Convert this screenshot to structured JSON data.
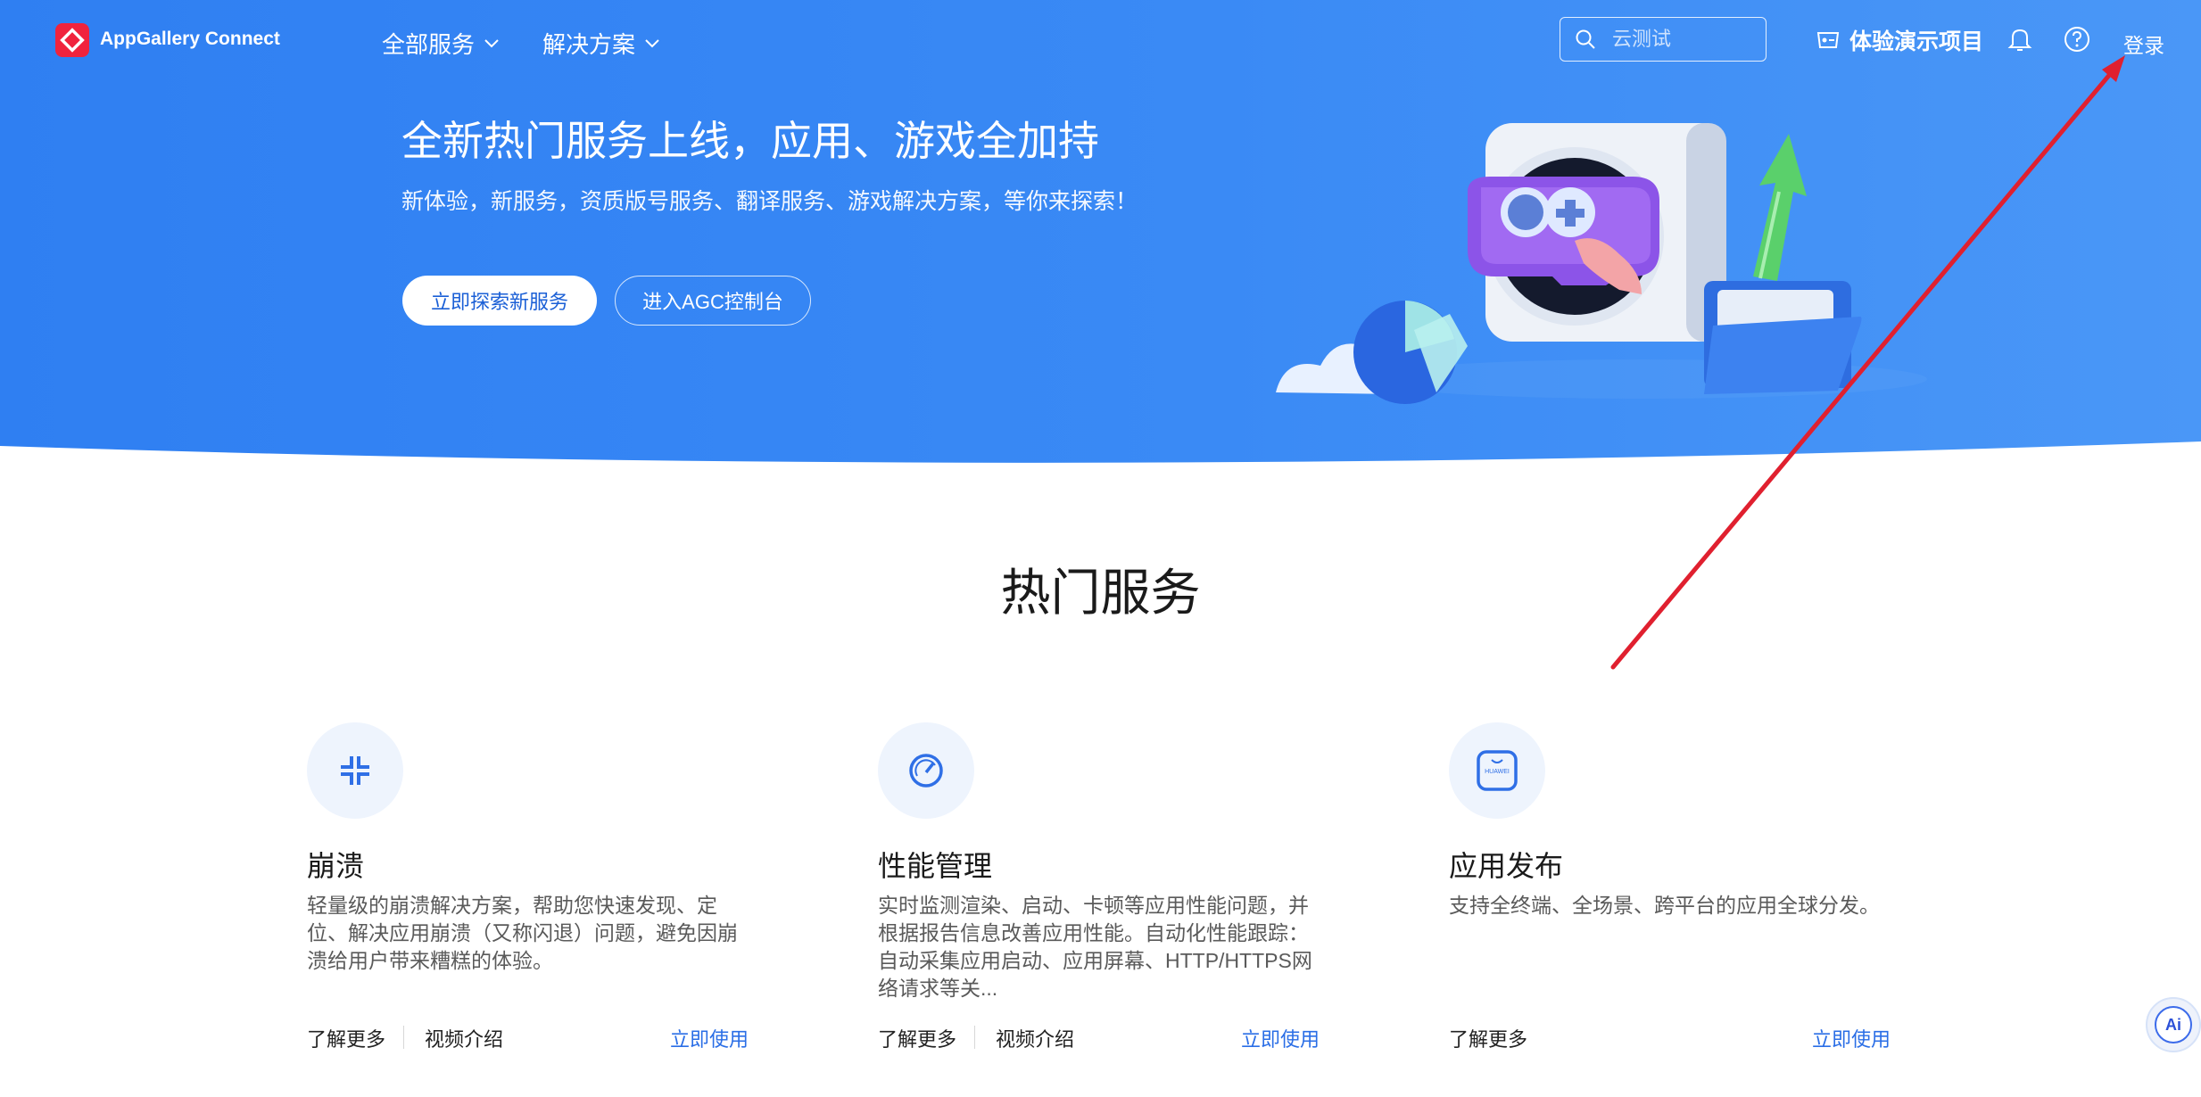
{
  "header": {
    "brand": "AppGallery Connect",
    "nav": [
      {
        "label": "全部服务"
      },
      {
        "label": "解决方案"
      }
    ],
    "search_placeholder": "云测试",
    "demo_label": "体验演示项目",
    "login_label": "登录"
  },
  "hero": {
    "title": "全新热门服务上线，应用、游戏全加持",
    "subtitle": "新体验，新服务，资质版号服务、翻译服务、游戏解决方案，等你来探索！",
    "primary_button": "立即探索新服务",
    "secondary_button": "进入AGC控制台"
  },
  "services": {
    "title": "热门服务",
    "cards": [
      {
        "title": "崩溃",
        "desc": "轻量级的崩溃解决方案，帮助您快速发现、定位、解决应用崩溃（又称闪退）问题，避免因崩溃给用户带来糟糕的体验。",
        "learn_more": "了解更多",
        "video": "视频介绍",
        "use_now": "立即使用",
        "icon": "crash-icon"
      },
      {
        "title": "性能管理",
        "desc": "实时监测渲染、启动、卡顿等应用性能问题，并根据报告信息改善应用性能。自动化性能跟踪：自动采集应用启动、应用屏幕、HTTP/HTTPS网络请求等关...",
        "learn_more": "了解更多",
        "video": "视频介绍",
        "use_now": "立即使用",
        "icon": "gauge-icon"
      },
      {
        "title": "应用发布",
        "desc": "支持全终端、全场景、跨平台的应用全球分发。",
        "learn_more": "了解更多",
        "use_now": "立即使用",
        "icon": "app-gallery-icon",
        "icon_text": "HUAWEI"
      }
    ]
  },
  "ai_assistant": {
    "label": "Ai"
  },
  "colors": {
    "hero_blue": "#3585f4",
    "link_blue": "#2a6ee6",
    "annotation_red": "#e0202f"
  }
}
